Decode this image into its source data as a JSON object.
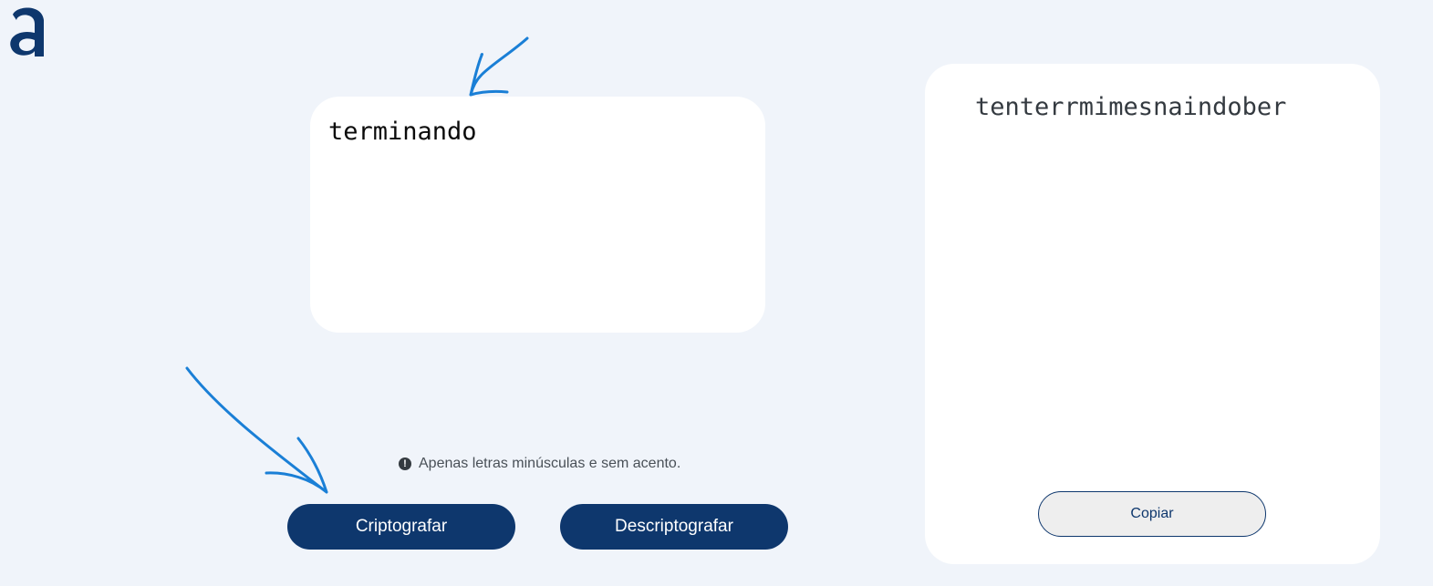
{
  "logo": {
    "icon": "alura-logo-icon",
    "color": "#0e376d"
  },
  "input": {
    "value": "terminando"
  },
  "hint": {
    "icon": "exclamation-circle-icon",
    "text": "Apenas letras minúsculas e sem acento."
  },
  "buttons": {
    "encrypt_label": "Criptografar",
    "decrypt_label": "Descriptografar",
    "copy_label": "Copiar"
  },
  "output": {
    "text": "tenterrmimesnaindober"
  },
  "colors": {
    "background": "#f0f4fa",
    "primary": "#0e376d",
    "annotation": "#1a7fd6"
  }
}
